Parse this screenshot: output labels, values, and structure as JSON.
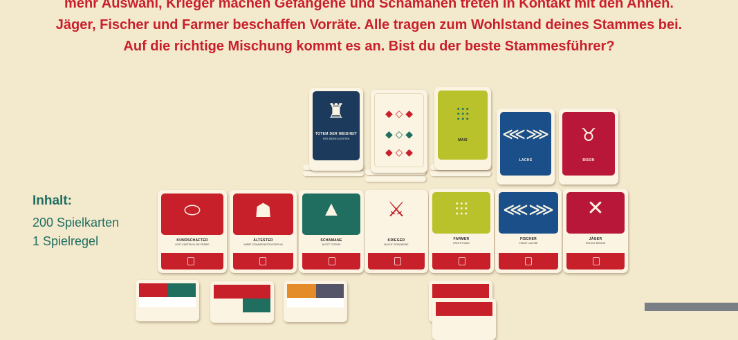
{
  "intro": {
    "line1": "mehr Auswahl, Krieger machen Gefangene und Schamanen treten in Kontakt mit den Ahnen.",
    "line2": "Jäger, Fischer und Farmer beschaffen Vorräte. Alle tragen zum Wohlstand deines Stammes bei.",
    "line3": "Auf die richtige Mischung kommt es an. Bist du der beste Stammesführer?"
  },
  "contents": {
    "heading": "Inhalt:",
    "item1": "200 Spielkarten",
    "item2": "1 Spielregel"
  },
  "colors": {
    "background": "#f3e9cd",
    "red": "#c8202b",
    "teal": "#1f6e60",
    "navy": "#1b3a5c",
    "lime": "#b9c22a",
    "crimson": "#b8173a"
  },
  "cards_top": [
    {
      "name": "TOTEM DER WEISHEIT",
      "text": "FÜR JEDEN ÄLTESTEN",
      "icon": "totem-icon"
    },
    {
      "name": "",
      "text": "",
      "icon": "pattern-icon"
    },
    {
      "name": "MAIS",
      "text": "",
      "icon": "corn-icon"
    },
    {
      "name": "LACHS",
      "text": "",
      "icon": "fish-icon"
    },
    {
      "name": "BISON",
      "text": "",
      "icon": "bison-icon"
    }
  ],
  "cards_row": [
    {
      "name": "KUNDSCHAFTER",
      "text": "LEGT KARTEN IN DIE PRÄRIE",
      "icon": "shield-icon"
    },
    {
      "name": "ÄLTESTER",
      "text": "WIRBT STAMMESMITGLIEDER AN",
      "icon": "elder-icon"
    },
    {
      "name": "SCHAMANE",
      "text": "NUTZT TOTEMS",
      "icon": "tipi-icon"
    },
    {
      "name": "KRIEGER",
      "text": "MACHT GEFANGENE",
      "icon": "axes-icon"
    },
    {
      "name": "FARMER",
      "text": "ERNTET MAIS",
      "icon": "field-icon"
    },
    {
      "name": "FISCHER",
      "text": "FÄNGT LACHSE",
      "icon": "fish-icon"
    },
    {
      "name": "JÄGER",
      "text": "ERLEGT BISONS",
      "icon": "arrows-icon"
    }
  ]
}
